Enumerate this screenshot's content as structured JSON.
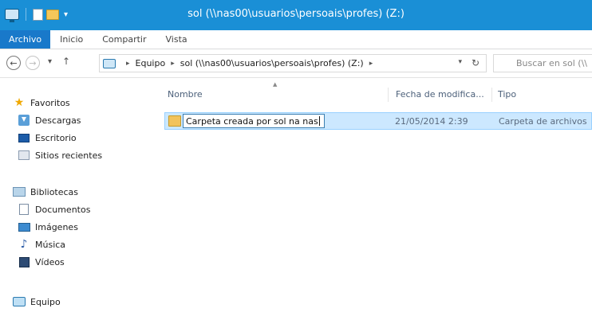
{
  "window": {
    "title": "sol (\\\\nas00\\usuarios\\persoais\\profes) (Z:)"
  },
  "ribbon": {
    "tabs": [
      {
        "label": "Archivo"
      },
      {
        "label": "Inicio"
      },
      {
        "label": "Compartir"
      },
      {
        "label": "Vista"
      }
    ]
  },
  "address": {
    "segments": [
      "Equipo",
      "sol (\\\\nas00\\usuarios\\persoais\\profes) (Z:)"
    ],
    "search_placeholder": "Buscar en sol (\\\\"
  },
  "navpane": {
    "favorites": {
      "label": "Favoritos"
    },
    "favorites_items": [
      {
        "label": "Descargas",
        "icon": "download-icon"
      },
      {
        "label": "Escritorio",
        "icon": "desktop-icon"
      },
      {
        "label": "Sitios recientes",
        "icon": "recent-places-icon"
      }
    ],
    "libraries": {
      "label": "Bibliotecas"
    },
    "library_items": [
      {
        "label": "Documentos",
        "icon": "documents-icon"
      },
      {
        "label": "Imágenes",
        "icon": "pictures-icon"
      },
      {
        "label": "Música",
        "icon": "music-icon"
      },
      {
        "label": "Vídeos",
        "icon": "videos-icon"
      }
    ],
    "computer": {
      "label": "Equipo"
    }
  },
  "filelist": {
    "columns": {
      "name": "Nombre",
      "date": "Fecha de modifica...",
      "type": "Tipo"
    },
    "rows": [
      {
        "name": "Carpeta creada por sol na nas",
        "date": "21/05/2014 2:39",
        "type": "Carpeta de archivos"
      }
    ]
  },
  "colors": {
    "titlebar": "#1a8fd6",
    "file_tab": "#1979ca",
    "selection": "#cce8ff"
  }
}
